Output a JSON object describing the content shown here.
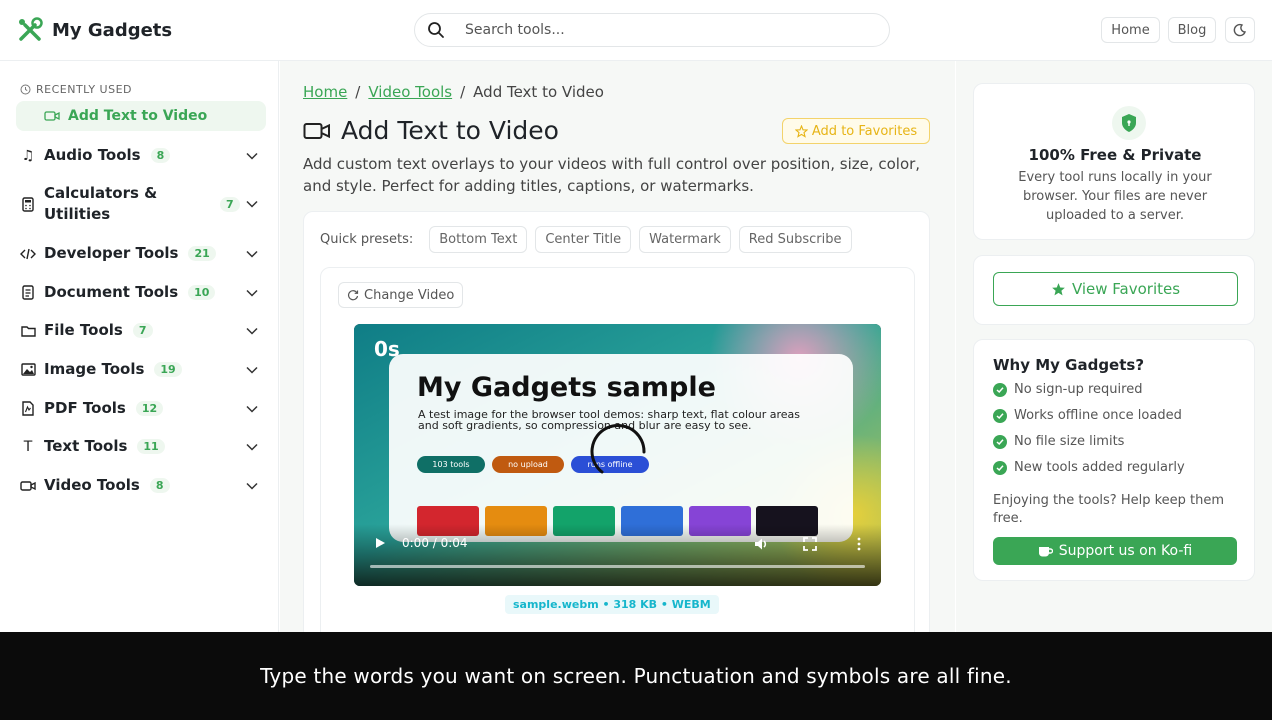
{
  "app": {
    "name": "My Gadgets"
  },
  "header": {
    "search_placeholder": "Search tools...",
    "nav": {
      "home": "Home",
      "blog": "Blog"
    }
  },
  "sidebar": {
    "recent_label": "RECENTLY USED",
    "recent_item": "Add Text to Video",
    "categories": [
      {
        "label": "Audio Tools",
        "count": "8",
        "icon": "music-icon"
      },
      {
        "label": "Calculators &",
        "label2": "Utilities",
        "count": "7",
        "icon": "calculator-icon"
      },
      {
        "label": "Developer Tools",
        "count": "21",
        "icon": "code-icon"
      },
      {
        "label": "Document Tools",
        "count": "10",
        "icon": "document-icon"
      },
      {
        "label": "File Tools",
        "count": "7",
        "icon": "folder-icon"
      },
      {
        "label": "Image Tools",
        "count": "19",
        "icon": "image-icon"
      },
      {
        "label": "PDF Tools",
        "count": "12",
        "icon": "pdf-icon"
      },
      {
        "label": "Text Tools",
        "count": "11",
        "icon": "text-icon"
      },
      {
        "label": "Video Tools",
        "count": "8",
        "icon": "video-icon"
      }
    ]
  },
  "main": {
    "breadcrumb": {
      "home": "Home",
      "sep": "/",
      "section": "Video Tools",
      "current": "Add Text to Video"
    },
    "title": "Add Text to Video",
    "favorites_button": "Add to Favorites",
    "description": "Add custom text overlays to your videos with full control over position, size, color, and style. Perfect for adding titles, captions, or watermarks.",
    "presets_label": "Quick presets:",
    "presets": [
      "Bottom Text",
      "Center Title",
      "Watermark",
      "Red Subscribe"
    ],
    "change_video": "Change Video",
    "video": {
      "overlay_time": "0s",
      "frame_title": "My Gadgets sample",
      "frame_subtitle": "A test image for the browser tool demos: sharp text, flat colour areas and soft gradients, so compression and blur are easy to see.",
      "pills": [
        "103 tools",
        "no upload",
        "runs offline"
      ],
      "time": "0:00 / 0:04",
      "progress": 0
    },
    "file_info": "sample.webm • 318 KB • WEBM"
  },
  "right": {
    "free_title": "100% Free & Private",
    "free_text": "Every tool runs locally in your browser. Your files are never uploaded to a server.",
    "view_favorites": "View Favorites",
    "why_title": "Why My Gadgets?",
    "why_items": [
      "No sign-up required",
      "Works offline once loaded",
      "No file size limits",
      "New tools added regularly"
    ],
    "enjoy_text": "Enjoying the tools? Help keep them free.",
    "kofi_button": "Support us on Ko-fi"
  },
  "caption": "Type the words you want on screen. Punctuation and symbols are all fine.",
  "colors": {
    "accent": "#3aa655",
    "favorite": "#e7b416",
    "badge": "#16b6cc"
  }
}
